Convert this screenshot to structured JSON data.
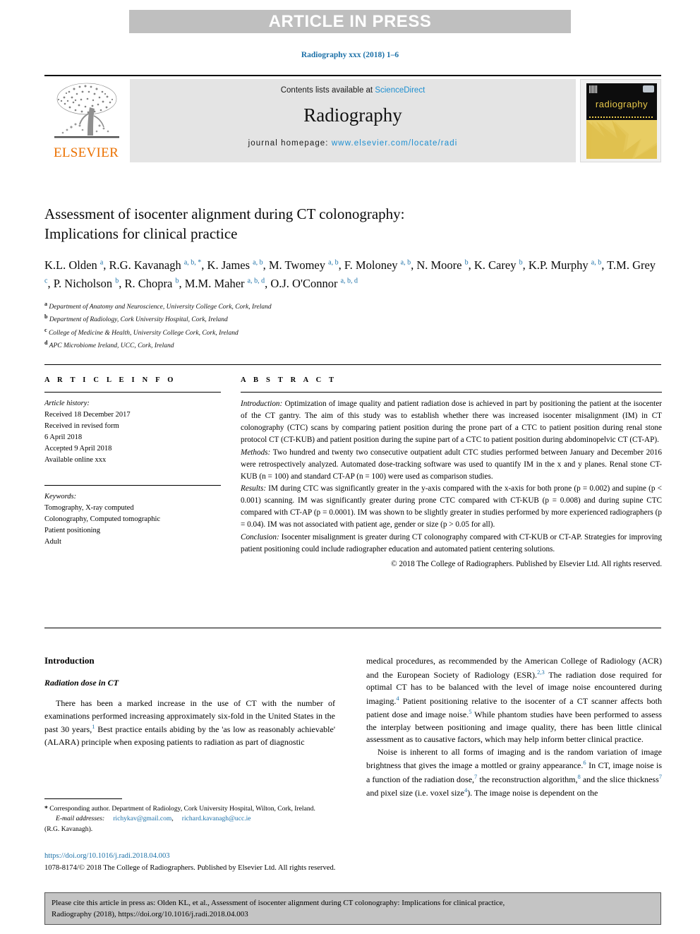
{
  "banner": {
    "text": "ARTICLE IN PRESS"
  },
  "journal_ref": "Radiography xxx (2018) 1–6",
  "masthead": {
    "publisher_logo_text": "ELSEVIER",
    "contents_prefix": "Contents lists available at ",
    "contents_link": "ScienceDirect",
    "journal_title": "Radiography",
    "homepage_prefix": "journal homepage: ",
    "homepage_link": "www.elsevier.com/locate/radi",
    "cover_title": "radiography"
  },
  "article": {
    "title_line1": "Assessment of isocenter alignment during CT colonography:",
    "title_line2": "Implications for clinical practice",
    "authors_html": "K.L. Olden <sup>a</sup>, R.G. Kavanagh <sup>a, b, *</sup>, K. James <sup>a, b</sup>, M. Twomey <sup>a, b</sup>, F. Moloney <sup>a, b</sup>, N. Moore <sup>b</sup>, K. Carey <sup>b</sup>, K.P. Murphy <sup>a, b</sup>, T.M. Grey <sup>c</sup>, P. Nicholson <sup>b</sup>, R. Chopra <sup>b</sup>, M.M. Maher <sup>a, b, d</sup>, O.J. O'Connor <sup>a, b, d</sup>",
    "affiliations": [
      {
        "mark": "a",
        "text": "Department of Anatomy and Neuroscience, University College Cork, Cork, Ireland"
      },
      {
        "mark": "b",
        "text": "Department of Radiology, Cork University Hospital, Cork, Ireland"
      },
      {
        "mark": "c",
        "text": "College of Medicine & Health, University College Cork, Cork, Ireland"
      },
      {
        "mark": "d",
        "text": "APC Microbiome Ireland, UCC, Cork, Ireland"
      }
    ]
  },
  "article_info": {
    "heading": "A R T I C L E   I N F O",
    "history_label": "Article history:",
    "history_lines": [
      "Received 18 December 2017",
      "Received in revised form",
      "6 April 2018",
      "Accepted 9 April 2018",
      "Available online xxx"
    ],
    "keywords_label": "Keywords:",
    "keywords": [
      "Tomography, X-ray computed",
      "Colonography, Computed tomographic",
      "Patient positioning",
      "Adult"
    ]
  },
  "abstract": {
    "heading": "A B S T R A C T",
    "sections": [
      {
        "label": "Introduction:",
        "text": " Optimization of image quality and patient radiation dose is achieved in part by positioning the patient at the isocenter of the CT gantry. The aim of this study was to establish whether there was increased isocenter misalignment (IM) in CT colonography (CTC) scans by comparing patient position during the prone part of a CTC to patient position during renal stone protocol CT (CT-KUB) and patient position during the supine part of a CTC to patient position during abdominopelvic CT (CT-AP)."
      },
      {
        "label": "Methods:",
        "text": " Two hundred and twenty two consecutive outpatient adult CTC studies performed between January and December 2016 were retrospectively analyzed. Automated dose-tracking software was used to quantify IM in the x and y planes. Renal stone CT-KUB (n = 100) and standard CT-AP (n = 100) were used as comparison studies."
      },
      {
        "label": "Results:",
        "text": " IM during CTC was significantly greater in the y-axis compared with the x-axis for both prone (p = 0.002) and supine (p < 0.001) scanning. IM was significantly greater during prone CTC compared with CT-KUB (p = 0.008) and during supine CTC compared with CT-AP (p = 0.0001). IM was shown to be slightly greater in studies performed by more experienced radiographers (p = 0.04). IM was not associated with patient age, gender or size (p > 0.05 for all)."
      },
      {
        "label": "Conclusion:",
        "text": " Isocenter misalignment is greater during CT colonography compared with CT-KUB or CT-AP. Strategies for improving patient positioning could include radiographer education and automated patient centering solutions."
      }
    ],
    "copyright": "© 2018 The College of Radiographers. Published by Elsevier Ltd. All rights reserved."
  },
  "body": {
    "section_heading": "Introduction",
    "subsection_heading": "Radiation dose in CT",
    "left_paragraph_html": "There has been a marked increase in the use of CT with the number of examinations performed increasing approximately six-fold in the United States in the past 30 years,<span class=\"ref\">1</span> Best practice entails abiding by the 'as low as reasonably achievable' (ALARA) principle when exposing patients to radiation as part of diagnostic",
    "right_paragraph1_html": "medical procedures, as recommended by the American College of Radiology (ACR) and the European Society of Radiology (ESR).<span class=\"ref\">2,3</span> The radiation dose required for optimal CT has to be balanced with the level of image noise encountered during imaging.<span class=\"ref\">4</span> Patient positioning relative to the isocenter of a CT scanner affects both patient dose and image noise.<span class=\"ref\">5</span> While phantom studies have been performed to assess the interplay between positioning and image quality, there has been little clinical assessment as to causative factors, which may help inform better clinical practice.",
    "right_paragraph2_html": "Noise is inherent to all forms of imaging and is the random variation of image brightness that gives the image a mottled or grainy appearance.<span class=\"ref\">6</span> In CT, image noise is a function of the radiation dose,<span class=\"ref\">7</span> the reconstruction algorithm,<span class=\"ref\">8</span> and the slice thickness<span class=\"ref\">7</span> and pixel size (i.e. voxel size<span class=\"ref\">4</span>). The image noise is dependent on the"
  },
  "footnote": {
    "corresponding_html": "<b>*</b> Corresponding author. Department of Radiology, Cork University Hospital, Wilton, Cork, Ireland.",
    "email_label": "E-mail addresses:",
    "email1": "richykav@gmail.com",
    "email2": "richard.kavanagh@ucc.ie",
    "email_owner": "(R.G. Kavanagh)."
  },
  "doi": {
    "url": "https://doi.org/10.1016/j.radi.2018.04.003",
    "issn_line": "1078-8174/© 2018 The College of Radiographers. Published by Elsevier Ltd. All rights reserved."
  },
  "cite_box": {
    "line1": "Please cite this article in press as: Olden KL, et al., Assessment of isocenter alignment during CT colonography: Implications for clinical practice,",
    "line2": "Radiography (2018), https://doi.org/10.1016/j.radi.2018.04.003"
  },
  "colors": {
    "link": "#1d8fd1",
    "ref_blue": "#1d71a8",
    "banner_grey": "#bfbfbf",
    "box_grey": "#e4e4e4",
    "elsevier_orange": "#eb7100",
    "cover_gold": "#e8cd63",
    "cite_grey": "#c4c4c4"
  }
}
